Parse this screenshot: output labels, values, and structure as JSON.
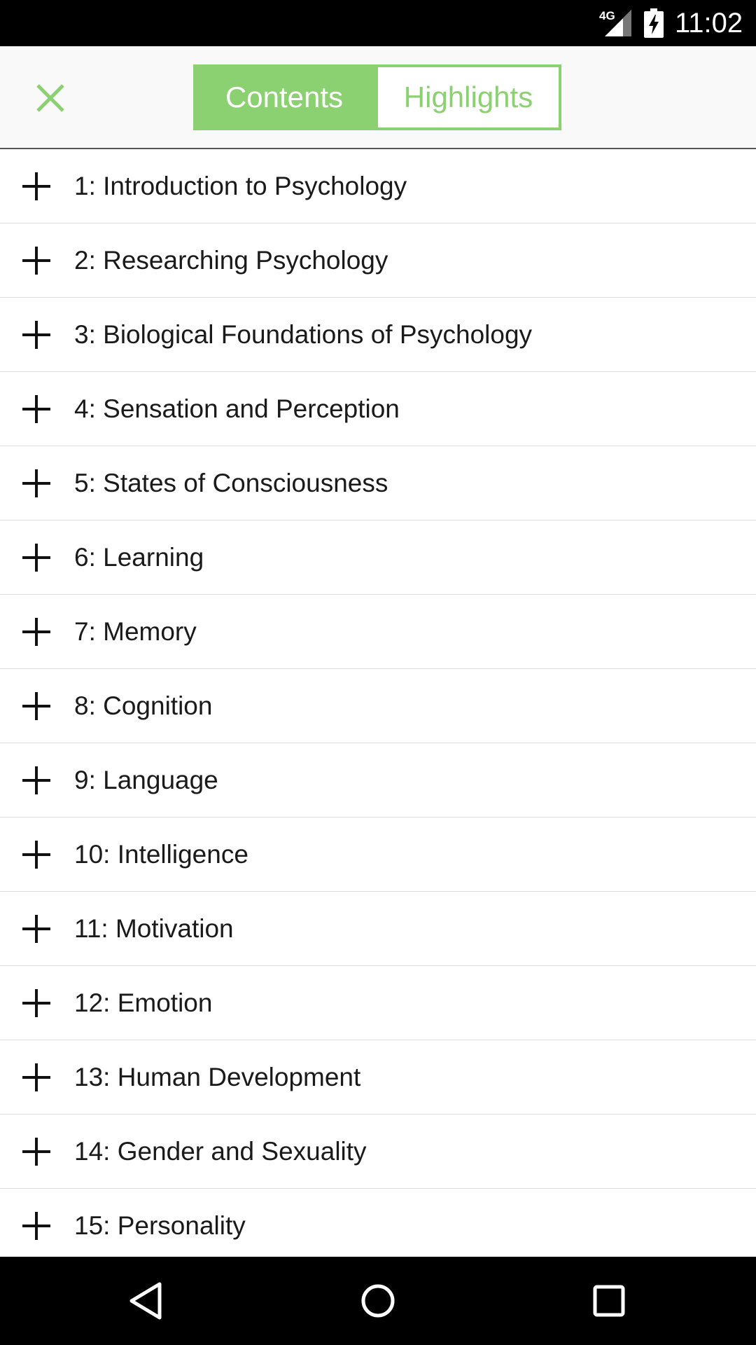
{
  "status_bar": {
    "network": "4G",
    "time": "11:02",
    "icons": [
      "signal-icon",
      "battery-charging-icon"
    ]
  },
  "header": {
    "close_icon": "close-icon",
    "tabs": [
      {
        "label": "Contents",
        "active": true
      },
      {
        "label": "Highlights",
        "active": false
      }
    ],
    "accent_color": "#8bd171"
  },
  "chapters": [
    {
      "label": "1: Introduction to Psychology"
    },
    {
      "label": "2: Researching Psychology"
    },
    {
      "label": "3: Biological Foundations of Psychology"
    },
    {
      "label": "4: Sensation and Perception"
    },
    {
      "label": "5: States of Consciousness"
    },
    {
      "label": "6: Learning"
    },
    {
      "label": "7: Memory"
    },
    {
      "label": "8: Cognition"
    },
    {
      "label": "9: Language"
    },
    {
      "label": "10: Intelligence"
    },
    {
      "label": "11: Motivation"
    },
    {
      "label": "12: Emotion"
    },
    {
      "label": "13: Human Development"
    },
    {
      "label": "14: Gender and Sexuality"
    },
    {
      "label": "15: Personality"
    }
  ],
  "nav_bar": {
    "buttons": [
      "back-icon",
      "home-icon",
      "recents-icon"
    ]
  }
}
